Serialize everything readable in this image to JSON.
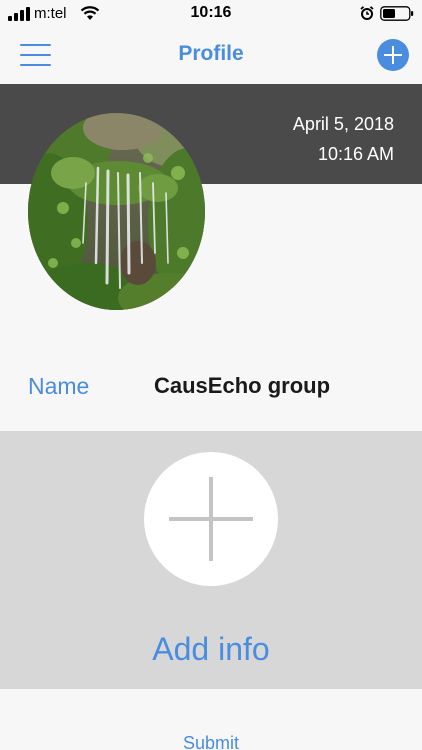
{
  "status_bar": {
    "carrier": "m:tel",
    "time": "10:16"
  },
  "nav": {
    "title": "Profile",
    "menu_icon": "hamburger-menu-icon",
    "add_icon": "plus-icon"
  },
  "header": {
    "date": "April 5, 2018",
    "time": "10:16 AM"
  },
  "profile": {
    "avatar_image": "waterfall photo",
    "name_label": "Name",
    "name_value": "CausEcho group"
  },
  "add_info": {
    "label": "Add info",
    "icon": "plus-icon"
  },
  "submit": {
    "label": "Submit"
  },
  "colors": {
    "accent": "#4a8de0",
    "header_band": "#4a4a4a",
    "panel": "#d7d7d7",
    "background": "#f7f7f7"
  }
}
